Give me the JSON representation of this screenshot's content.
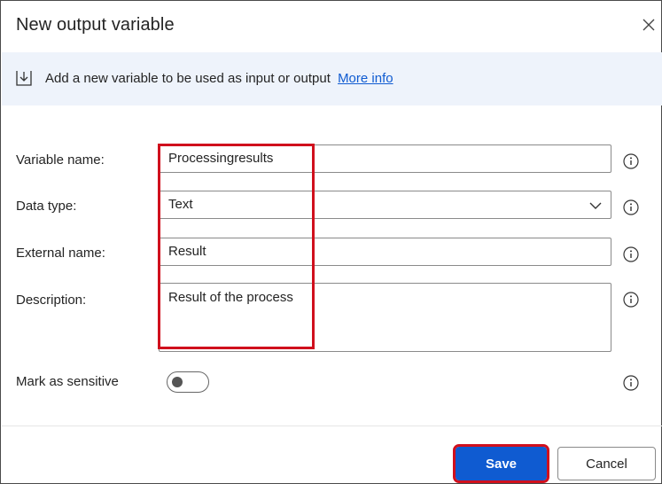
{
  "dialog": {
    "title": "New output variable",
    "info_message": "Add a new variable to be used as input or output",
    "info_link": "More info"
  },
  "form": {
    "variable_name": {
      "label": "Variable name:",
      "value": "Processingresults"
    },
    "data_type": {
      "label": "Data type:",
      "value": "Text"
    },
    "external_name": {
      "label": "External name:",
      "value": "Result"
    },
    "description": {
      "label": "Description:",
      "value": "Result of the process"
    },
    "sensitive": {
      "label": "Mark as sensitive",
      "enabled": false
    }
  },
  "buttons": {
    "save": "Save",
    "cancel": "Cancel"
  },
  "colors": {
    "accent": "#0f5bd1",
    "highlight": "#d0101d",
    "info_bar": "#eef3fb"
  },
  "icons": [
    "close-icon",
    "download-icon",
    "info-icon",
    "chevron-down-icon"
  ]
}
